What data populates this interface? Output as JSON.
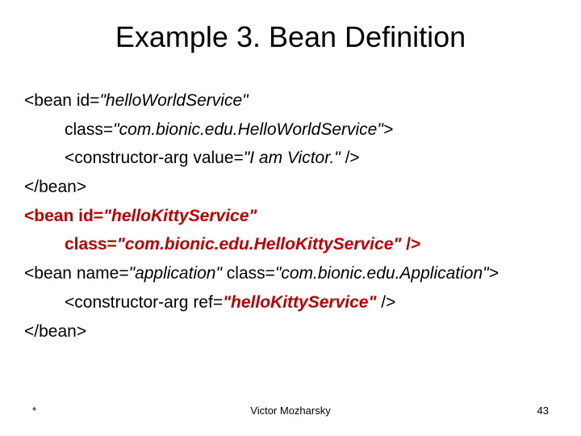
{
  "title": "Example 3. Bean Definition",
  "code": {
    "l1a": "<bean id=",
    "l1b": "\"helloWorldService\"",
    "l2a": "class=",
    "l2b": "\"com.bionic.edu.HelloWorldService\">",
    "l3a": "<constructor-arg value=",
    "l3b": "\"I am Victor.\"",
    "l3c": " />",
    "l4": "</bean>",
    "l5a": "<bean id=",
    "l5b": "\"helloKittyService\"",
    "l6a": "class=",
    "l6b": "\"com.bionic.edu.HelloKittyService\"",
    "l6c": " />",
    "l7a": "<bean name=",
    "l7b": "\"application\"",
    "l7c": " class=",
    "l7d": "\"com.bionic.edu.Application\">",
    "l8a": "<constructor-arg ref=",
    "l8b": "\"helloKittyService\"",
    "l8c": " />",
    "l9": "</bean>"
  },
  "footer": {
    "left": "*",
    "center": "Victor Mozharsky",
    "right": "43"
  }
}
